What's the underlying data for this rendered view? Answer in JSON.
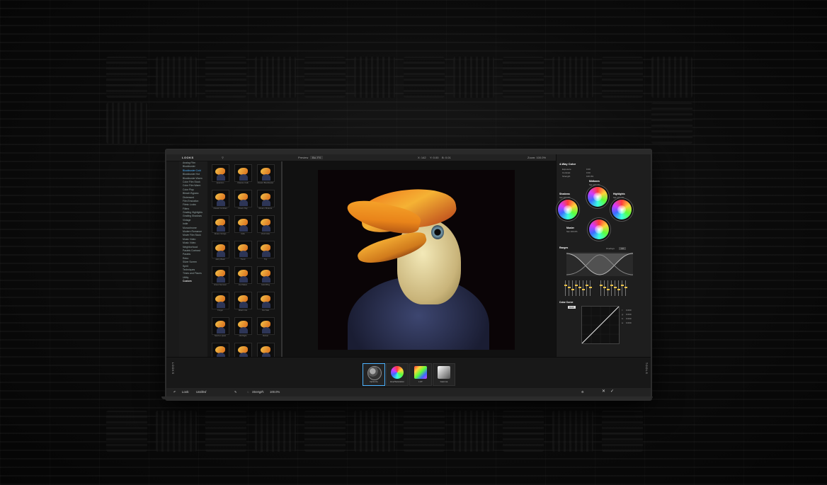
{
  "app": {
    "looks_header": "LOOKS",
    "controls_header": "CONTROLS",
    "toolbar": {
      "preview_label": "Preview",
      "preset": "Bo. FX",
      "coords_1": "X: 142",
      "coords_2": "Y: 0.00",
      "coords_3": "B: 0.01",
      "zoom": "Zoom: 100.0%"
    }
  },
  "sidebar": {
    "categories": [
      "Analog Film",
      "Blockbuster",
      "Blockbuster Cold",
      "Blockbuster Hot",
      "Blockbuster Warm",
      "Color Film Stock",
      "Color Film Warm",
      "Color Play",
      "Bleach Bypass",
      "Distressed",
      "Film Emulation",
      "Filmic Looks",
      "Filters",
      "Grading Highlights",
      "Grading Shadows",
      "Vintage",
      "Indie",
      "Monochrome",
      "Modern Romance",
      "Movie Film Stock",
      "Music Video",
      "Music Video",
      "Neighborhood",
      "Pastels Contrast",
      "Pastels",
      "Retro",
      "Silver Screen",
      "Spirit",
      "Techniques",
      "Times and Places",
      "Utility",
      "Custom"
    ],
    "active_index": 2,
    "custom_label": "Custom"
  },
  "looks": {
    "rows": [
      [
        "Quantum",
        "Cleanse Cafe",
        "Classic Blockbuster"
      ],
      [
        "Classic Contrast",
        "Dream Day",
        "Dream Vibrance"
      ],
      [
        "Dream Vertigo",
        "Indie",
        "Vivid Color"
      ],
      [
        "Jazzy Basic",
        "Trend",
        "Trip"
      ],
      [
        "Green Summer",
        "Ice Palace",
        "Gold Wing"
      ],
      [
        "Forget",
        "Watch Out",
        "Our Fate"
      ],
      [
        "North in Quiet",
        "Old Night",
        "Refuel"
      ],
      [
        "",
        "",
        ""
      ]
    ]
  },
  "controls": {
    "section_title": "4-Way Color",
    "exposure_label": "Exposure",
    "exposure_value": "0.00",
    "contrast_label": "Contrast",
    "contrast_value": "0.00",
    "strength_label": "Strength",
    "strength_value": "100.0%",
    "wheels": {
      "shadows": {
        "label": "Shadows",
        "sat_label": "Sat",
        "sat_value": "100.0%"
      },
      "midtones": {
        "label": "Midtones",
        "sat_label": "Sat",
        "sat_value": "100.0%"
      },
      "highlights": {
        "label": "Highlights",
        "sat_label": "Sat",
        "sat_value": "100.0%"
      },
      "master": {
        "label": "Master",
        "sat_label": "Sat",
        "sat_value": "100.0%"
      }
    },
    "ranges_label": "Ranges",
    "overlays_label": "Overlays",
    "overlays_toggle": "Off",
    "color_curve_label": "Color Curve",
    "curve_channel": "RGB",
    "curve_values": [
      "0.000",
      "0.000",
      "0.000",
      "0.000"
    ],
    "curve_axes": [
      "r:",
      "g:",
      "b:",
      "a:"
    ]
  },
  "filters": {
    "items": [
      {
        "label": "Optimize",
        "active": true
      },
      {
        "label": "Hue/Saturation",
        "active": false
      },
      {
        "label": "LUT",
        "active": false
      },
      {
        "label": "Gamma",
        "active": false
      }
    ],
    "left_tab": "LOOKS",
    "right_tab": "TOOLS"
  },
  "status": {
    "look_label": "Look:",
    "look_name": "Untitled",
    "strength_label": "Strength:",
    "strength_value": "100.0%"
  }
}
